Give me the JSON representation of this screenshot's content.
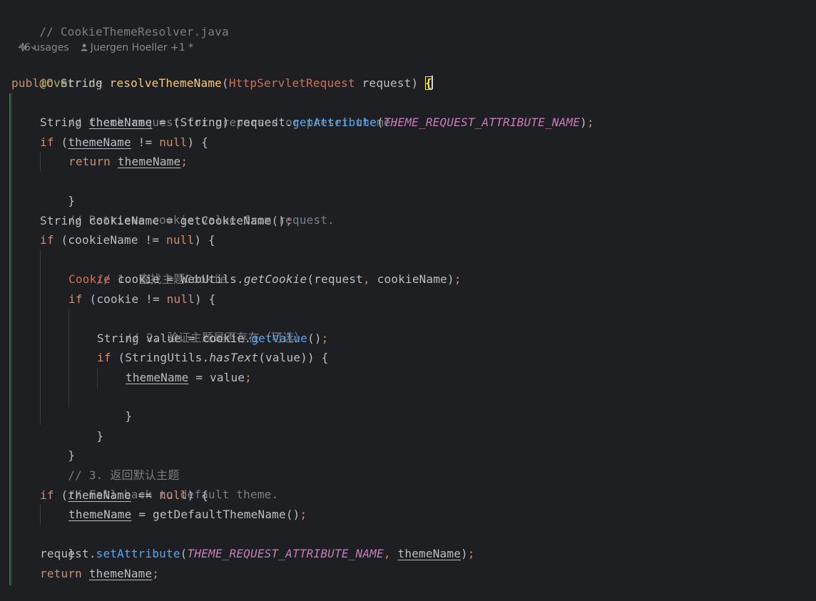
{
  "editor": {
    "file_comment": "// CookieThemeResolver.java",
    "usages": "6 usages",
    "author": "Juergen Hoeller +1 *",
    "lines": {
      "l1_annotation": "@Override",
      "l2_public": "public",
      "l2_string": " String ",
      "l2_method": "resolveThemeName",
      "l2_open": "(",
      "l2_type": "HttpServletRequest",
      "l2_param": " request) ",
      "l2_brace": "{",
      "l3_comment": "// Check request for preparsed or preset theme.",
      "l4_a": "String ",
      "l4_var": "themeName",
      "l4_b": " = (String) request.",
      "l4_call": "getAttribute",
      "l4_c": "(",
      "l4_const": "THEME_REQUEST_ATTRIBUTE_NAME",
      "l4_d": ")",
      "l4_semi": ";",
      "l5_if": "if",
      "l5_a": " (",
      "l5_var": "themeName",
      "l5_b": " != ",
      "l5_null": "null",
      "l5_c": ") {",
      "l6_return": "return",
      "l6_sp": " ",
      "l6_var": "themeName",
      "l6_semi": ";",
      "l7_close": "}",
      "l8_comment": "// Retrieve cookie value from request.",
      "l9_a": "String cookieName = getCookieName()",
      "l9_semi": ";",
      "l10_if": "if",
      "l10_a": " (cookieName != ",
      "l10_null": "null",
      "l10_b": ") {",
      "l11_comment": "// 1. 查找主题Cookie",
      "l12_type": "Cookie",
      "l12_a": " cookie = WebUtils.",
      "l12_static": "getCookie",
      "l12_b": "(request",
      "l12_comma": ",",
      "l12_c": " cookieName)",
      "l12_semi": ";",
      "l13_if": "if",
      "l13_a": " (cookie != ",
      "l13_null": "null",
      "l13_b": ") {",
      "l14_comment": "// 2. 验证主题是否存在（可选）",
      "l15_a": "String value = cookie.",
      "l15_call": "getValue",
      "l15_b": "()",
      "l15_semi": ";",
      "l16_if": "if",
      "l16_a": " (StringUtils.",
      "l16_static": "hasText",
      "l16_b": "(value)) {",
      "l17_var": "themeName",
      "l17_a": " = value",
      "l17_semi": ";",
      "l18_close": "}",
      "l19_close": "}",
      "l20_close": "}",
      "l21_comment": "// 3. 返回默认主题",
      "l22_comment": "// Fall back to default theme.",
      "l23_if": "if",
      "l23_a": " (",
      "l23_var": "themeName",
      "l23_b": " == ",
      "l23_null": "null",
      "l23_c": ") {",
      "l24_var": "themeName",
      "l24_a": " = getDefaultThemeName()",
      "l24_semi": ";",
      "l25_close": "}",
      "l26_a": "request.",
      "l26_call": "setAttribute",
      "l26_b": "(",
      "l26_const": "THEME_REQUEST_ATTRIBUTE_NAME",
      "l26_comma": ",",
      "l26_sp": " ",
      "l26_var": "themeName",
      "l26_c": ")",
      "l26_semi": ";",
      "l27_return": "return",
      "l27_sp": " ",
      "l27_var": "themeName",
      "l27_semi": ";",
      "l28_close": "}"
    },
    "colors": {
      "background": "#1e1f22",
      "keyword": "#cf8e6d",
      "annotation": "#b3ae60",
      "method_declaration": "#ffc66d",
      "method_call": "#56a8f5",
      "constant": "#c77dbb",
      "comment": "#7a7e85",
      "brace_match": "#ffef28"
    },
    "icons": {
      "author": "person-icon",
      "inlay_toggle": "ai-sparkle-icon"
    }
  }
}
